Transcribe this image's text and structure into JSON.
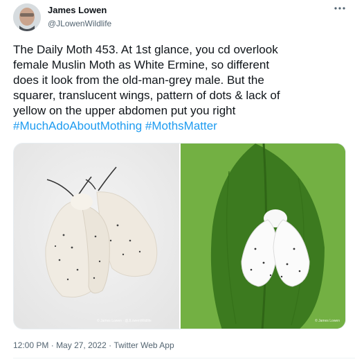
{
  "author": {
    "name": "James Lowen",
    "handle": "@JLowenWildlife"
  },
  "tweet": {
    "lines": [
      "The Daily Moth 453. At 1st glance, you cd overlook",
      "female Muslin Moth as White Ermine, so different",
      "does it look from the old-man-grey male. But the",
      "squarer, translucent wings, pattern of dots & lack of",
      "yellow on the upper abdomen put you right"
    ],
    "hashtags": [
      "#MuchAdoAboutMothing",
      "#MothsMatter"
    ]
  },
  "media": {
    "credit_left": "© James Lowen · @JLowenWildlife",
    "credit_right": "© James Lowen"
  },
  "meta": {
    "time": "12:00 PM",
    "date": "May 27, 2022",
    "source": "Twitter Web App",
    "sep": "·"
  },
  "colors": {
    "link": "#1d9bf0",
    "secondary_text": "#536471"
  },
  "icons": {
    "more": "more-options-icon"
  }
}
